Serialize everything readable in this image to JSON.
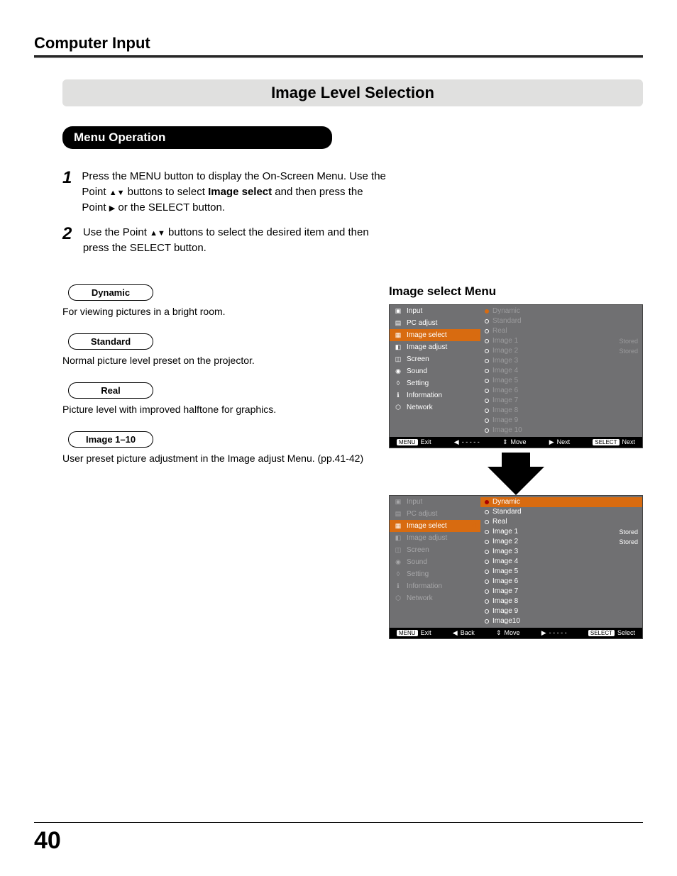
{
  "chapter": "Computer Input",
  "section_title": "Image Level Selection",
  "menu_operation_heading": "Menu Operation",
  "steps": {
    "s1_pre": "Press the MENU button to display the On-Screen Menu. Use the Point ",
    "s1_mid": " buttons to select ",
    "s1_bold": "Image select",
    "s1_mid2": " and then press the Point ",
    "s1_post": " or the SELECT button.",
    "s2_pre": "Use the Point ",
    "s2_post": " buttons to select the desired item and then press the SELECT button."
  },
  "tags": [
    {
      "label": "Dynamic",
      "desc": "For viewing pictures in a bright room."
    },
    {
      "label": "Standard",
      "desc": "Normal picture level preset on the projector."
    },
    {
      "label": "Real",
      "desc": "Picture level with improved halftone for graphics."
    },
    {
      "label": "Image 1–10",
      "desc": "User preset picture adjustment in the Image adjust Menu. (pp.41-42)"
    }
  ],
  "right_heading": "Image select Menu",
  "menu_left": [
    "Input",
    "PC adjust",
    "Image select",
    "Image adjust",
    "Screen",
    "Sound",
    "Setting",
    "Information",
    "Network"
  ],
  "opts1": [
    {
      "label": "Dynamic",
      "selected": true,
      "stored": ""
    },
    {
      "label": "Standard",
      "selected": false,
      "stored": ""
    },
    {
      "label": "Real",
      "selected": false,
      "stored": ""
    },
    {
      "label": "Image 1",
      "selected": false,
      "stored": "Stored"
    },
    {
      "label": "Image 2",
      "selected": false,
      "stored": "Stored"
    },
    {
      "label": "Image 3",
      "selected": false,
      "stored": ""
    },
    {
      "label": "Image 4",
      "selected": false,
      "stored": ""
    },
    {
      "label": "Image 5",
      "selected": false,
      "stored": ""
    },
    {
      "label": "Image 6",
      "selected": false,
      "stored": ""
    },
    {
      "label": "Image 7",
      "selected": false,
      "stored": ""
    },
    {
      "label": "Image 8",
      "selected": false,
      "stored": ""
    },
    {
      "label": "Image 9",
      "selected": false,
      "stored": ""
    },
    {
      "label": "Image 10",
      "selected": false,
      "stored": ""
    }
  ],
  "opts2": [
    {
      "label": "Dynamic",
      "selected": true,
      "stored": ""
    },
    {
      "label": "Standard",
      "selected": false,
      "stored": ""
    },
    {
      "label": "Real",
      "selected": false,
      "stored": ""
    },
    {
      "label": "Image 1",
      "selected": false,
      "stored": "Stored"
    },
    {
      "label": "Image 2",
      "selected": false,
      "stored": "Stored"
    },
    {
      "label": "Image 3",
      "selected": false,
      "stored": ""
    },
    {
      "label": "Image 4",
      "selected": false,
      "stored": ""
    },
    {
      "label": "Image 5",
      "selected": false,
      "stored": ""
    },
    {
      "label": "Image 6",
      "selected": false,
      "stored": ""
    },
    {
      "label": "Image 7",
      "selected": false,
      "stored": ""
    },
    {
      "label": "Image 8",
      "selected": false,
      "stored": ""
    },
    {
      "label": "Image 9",
      "selected": false,
      "stored": ""
    },
    {
      "label": "Image10",
      "selected": false,
      "stored": ""
    }
  ],
  "bar1": {
    "exit": "Exit",
    "menu": "MENU",
    "dash": "- - - - -",
    "move": "Move",
    "next": "Next",
    "select": "Next",
    "sel_kbd": "SELECT"
  },
  "bar2": {
    "exit": "Exit",
    "menu": "MENU",
    "back": "Back",
    "move": "Move",
    "dash": "- - - - -",
    "select": "Select",
    "sel_kbd": "SELECT"
  },
  "icons": {
    "up": "▲",
    "down": "▼",
    "right": "▶",
    "left": "◀",
    "updown": "⇕"
  },
  "page_number": "40"
}
